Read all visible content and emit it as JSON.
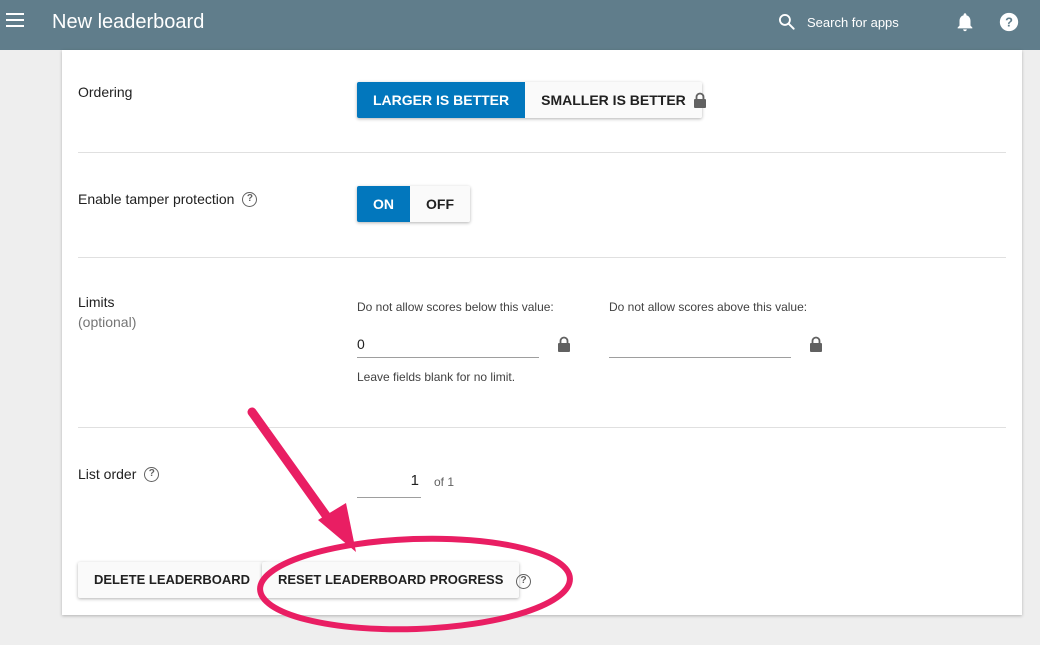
{
  "header": {
    "title": "New leaderboard",
    "search_label": "Search for apps",
    "menu_icon": "menu-icon",
    "search_icon": "search-icon",
    "bell_icon": "notifications-icon",
    "help_icon": "help-icon"
  },
  "ordering": {
    "label": "Ordering",
    "options": [
      "LARGER IS BETTER",
      "SMALLER IS BETTER"
    ],
    "selected": "LARGER IS BETTER"
  },
  "tamper": {
    "label": "Enable tamper protection",
    "options": [
      "ON",
      "OFF"
    ],
    "selected": "ON"
  },
  "limits": {
    "label": "Limits",
    "sublabel": "(optional)",
    "min_label": "Do not allow scores below this value:",
    "min_value": "0",
    "max_label": "Do not allow scores above this value:",
    "max_value": "",
    "hint": "Leave fields blank for no limit."
  },
  "list_order": {
    "label": "List order",
    "value": "1",
    "of_text": "of 1"
  },
  "actions": {
    "delete_label": "DELETE LEADERBOARD",
    "reset_label": "RESET LEADERBOARD PROGRESS"
  },
  "colors": {
    "header_bg": "#607d8b",
    "accent": "#0277bd",
    "annotation": "#e91e63"
  }
}
